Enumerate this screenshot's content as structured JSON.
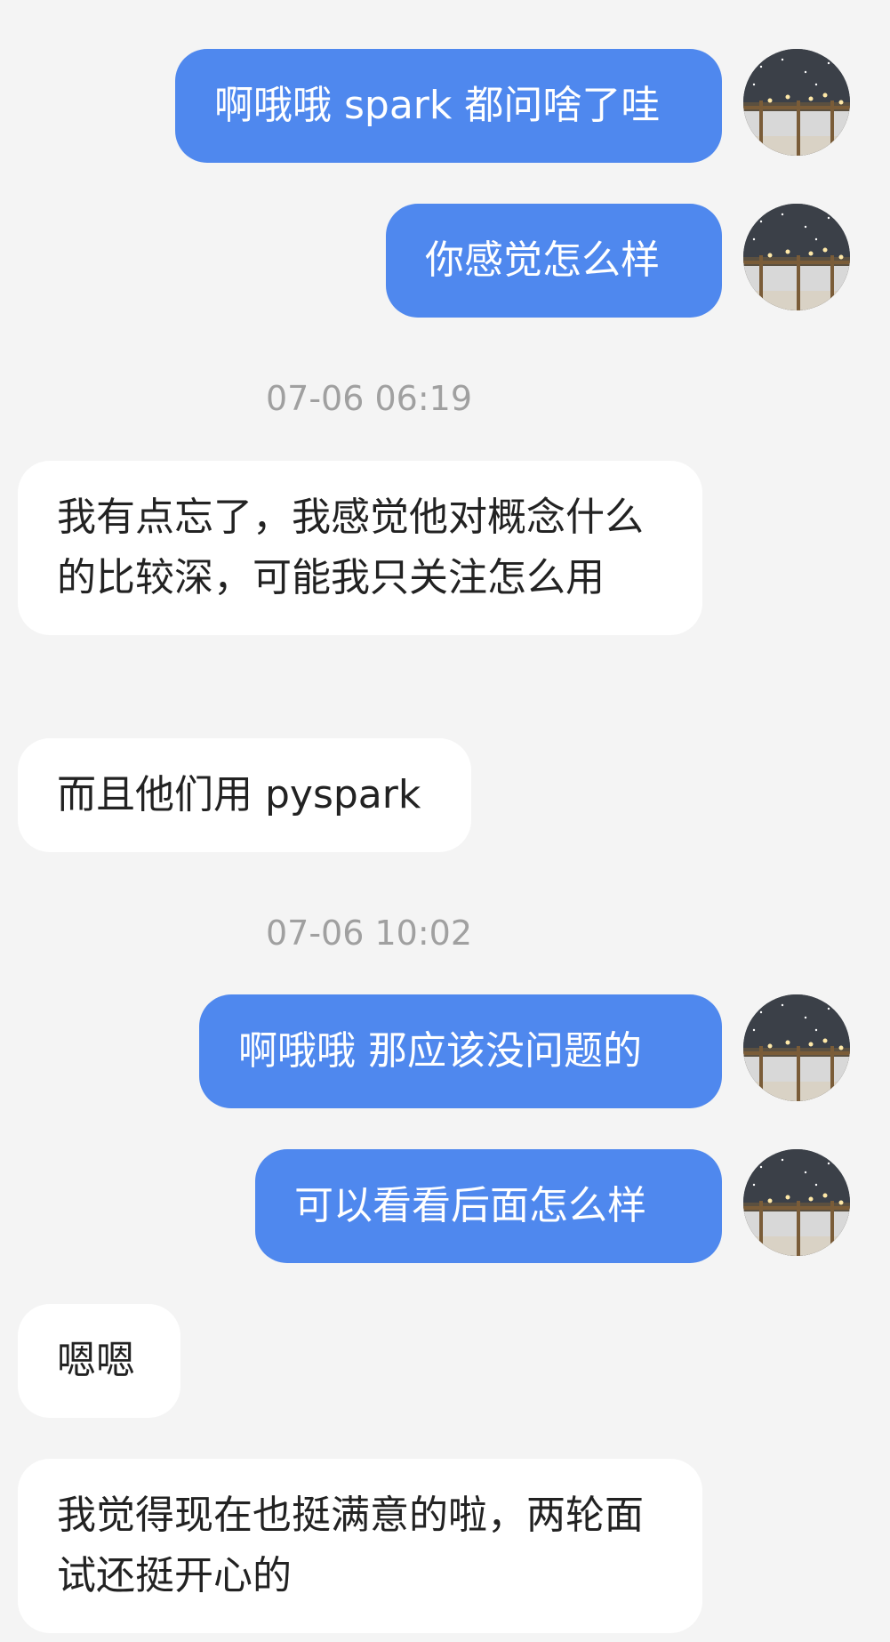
{
  "messages": [
    {
      "type": "outgoing",
      "text": "啊哦哦 spark 都问啥了哇"
    },
    {
      "type": "outgoing",
      "text": "你感觉怎么样"
    },
    {
      "type": "timestamp",
      "text": "07-06 06:19"
    },
    {
      "type": "incoming",
      "text": "我有点忘了，我感觉他对概念什么的比较深，可能我只关注怎么用"
    },
    {
      "type": "incoming",
      "text": "而且他们用 pyspark"
    },
    {
      "type": "timestamp",
      "text": "07-06 10:02"
    },
    {
      "type": "outgoing",
      "text": "啊哦哦 那应该没问题的"
    },
    {
      "type": "outgoing",
      "text": "可以看看后面怎么样"
    },
    {
      "type": "incoming",
      "text": "嗯嗯"
    },
    {
      "type": "incoming",
      "text": "我觉得现在也挺满意的啦，两轮面试还挺开心的"
    }
  ],
  "colors": {
    "outgoing_bubble": "#4f88ee",
    "incoming_bubble": "#ffffff",
    "background": "#f4f4f4",
    "timestamp_text": "#a0a0a0"
  },
  "icons": {
    "avatar": "snowy-night-window-avatar-icon"
  }
}
